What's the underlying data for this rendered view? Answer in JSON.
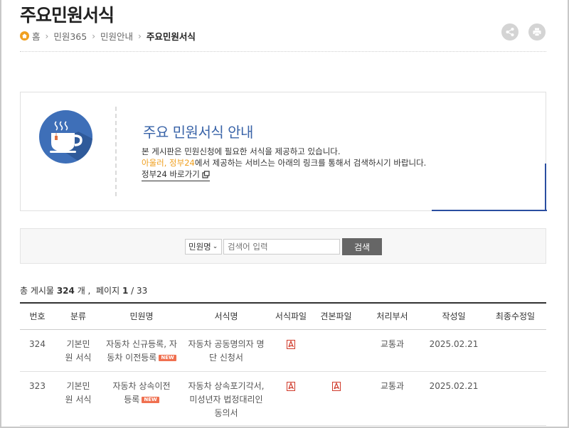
{
  "page": {
    "title": "주요민원서식"
  },
  "breadcrumb": {
    "items": [
      "홈",
      "민원365",
      "민원안내"
    ],
    "current": "주요민원서식"
  },
  "tools": {
    "share_icon": "share-icon",
    "print_icon": "print-icon"
  },
  "info": {
    "icon": "coffee-cup-icon",
    "title": "주요 민원서식 안내",
    "line1": "본 게시판은 민원신청에 필요한 서식을 제공하고 있습니다.",
    "line2_highlight": "아울러, 정부24",
    "line2_rest": "에서 제공하는 서비스는 아래의 링크를 통해서 검색하시기 바랍니다.",
    "link_label": "정부24 바로가기",
    "highlight_color": "#f0a020",
    "accent_color": "#3a64a8"
  },
  "search": {
    "select_value": "민원명",
    "placeholder": "검색어 입력",
    "button_label": "검색"
  },
  "summary": {
    "prefix": "총 게시물",
    "total": "324",
    "unit": "개 ,",
    "page_label": "페이지",
    "page_current": "1",
    "page_total": "/ 33"
  },
  "table": {
    "columns": [
      "번호",
      "분류",
      "민원명",
      "서식명",
      "서식파일",
      "견본파일",
      "처리부서",
      "작성일",
      "최종수정일"
    ],
    "rows": [
      {
        "no": "324",
        "category": "기본민원 서식",
        "name": "자동차 신규등록, 자동차 이전등록",
        "is_new": true,
        "form": "자동차 공동명의자 명단 신청서",
        "form_file": "pdf",
        "sample_file": "",
        "dept": "교통과",
        "created": "2025.02.21",
        "modified": ""
      },
      {
        "no": "323",
        "category": "기본민원 서식",
        "name": "자동차 상속이전등록",
        "is_new": true,
        "form": "자동차 상속포기각서, 미성년자 법정대리인 동의서",
        "form_file": "pdf",
        "sample_file": "pdf",
        "dept": "교통과",
        "created": "2025.02.21",
        "modified": ""
      }
    ],
    "new_badge": "NEW"
  }
}
